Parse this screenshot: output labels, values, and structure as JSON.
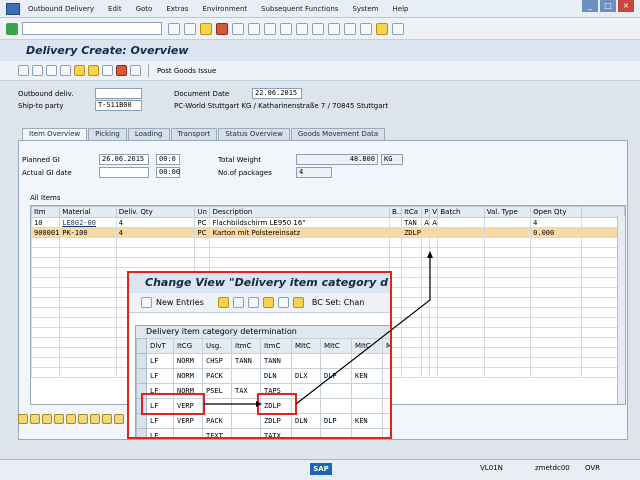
{
  "menubar": {
    "items": [
      "Outbound Delivery",
      "Edit",
      "Goto",
      "Extras",
      "Environment",
      "Subsequent Functions",
      "System",
      "Help"
    ]
  },
  "screen": {
    "title": "Delivery  Create: Overview",
    "app_toolbar_label": "Post Goods Issue"
  },
  "header": {
    "outbound_deliv_label": "Outbound deliv.",
    "outbound_deliv_value": "",
    "ship_to_label": "Ship-to party",
    "ship_to_value": "T-S11B00",
    "document_date_label": "Document Date",
    "document_date_value": "22.06.2015",
    "ship_to_text": "PC-World Stuttgart KG / Katharinenstraße 7 / 70845 Stuttgart"
  },
  "tabs": [
    {
      "label": "Item Overview",
      "active": true
    },
    {
      "label": "Picking",
      "active": false
    },
    {
      "label": "Loading",
      "active": false
    },
    {
      "label": "Transport",
      "active": false
    },
    {
      "label": "Status Overview",
      "active": false
    },
    {
      "label": "Goods Movement Data",
      "active": false
    }
  ],
  "item_overview": {
    "planned_gi_label": "Planned GI",
    "planned_gi_date": "26.06.2015",
    "planned_gi_time": "00:0",
    "actual_gi_label": "Actual GI date",
    "actual_gi_time": "00:00",
    "total_weight_label": "Total Weight",
    "total_weight_value": "48.800",
    "total_weight_unit": "KG",
    "no_packages_label": "No.of packages",
    "no_packages_value": "4",
    "all_items_label": "All Items",
    "columns": [
      "Itm",
      "Material",
      "Deliv. Qty",
      "Un",
      "Description",
      "B..",
      "ItCa",
      "P",
      "V",
      "Batch",
      "Val. Type",
      "Open Qty"
    ],
    "rows": [
      {
        "itm": "10",
        "material": "LE802-00",
        "qty": "4",
        "un": "PC",
        "desc": "Flachbildschirm LE950 16\"",
        "itca": "TAN",
        "p": "A",
        "v": "A",
        "batch": "",
        "valtype": "",
        "openqty": "4",
        "selected": false
      },
      {
        "itm": "900001",
        "material": "PK-100",
        "qty": "4",
        "un": "PC",
        "desc": "Karton mit Polstereinsatz",
        "itca": "ZDLP",
        "p": "",
        "v": "",
        "batch": "",
        "valtype": "",
        "openqty": "0.000",
        "selected": true
      }
    ]
  },
  "popup": {
    "title": "Change View \"Delivery item category d",
    "new_entries_label": "New Entries",
    "bc_set_label": "BC Set: Chan",
    "grid_title": "Delivery item category determination",
    "columns": [
      "DlvT",
      "ItCG",
      "Usg.",
      "ItmC",
      "ItmC",
      "MItC",
      "MItC",
      "MItC",
      "M"
    ],
    "rows": [
      [
        "LF",
        "NORM",
        "CHSP",
        "TANN",
        "TANN",
        "",
        "",
        "",
        ""
      ],
      [
        "LF",
        "NORM",
        "PACK",
        "",
        "DLN",
        "DLX",
        "DLP",
        "KEN",
        ""
      ],
      [
        "LF",
        "NORM",
        "PSEL",
        "TAX",
        "TAPS",
        "",
        "",
        "",
        ""
      ],
      [
        "LF",
        "VERP",
        "",
        "",
        "ZDLP",
        "",
        "",
        "",
        ""
      ],
      [
        "LF",
        "VERP",
        "PACK",
        "",
        "ZDLP",
        "DLN",
        "DLP",
        "KEN",
        ""
      ],
      [
        "LF",
        "",
        "TEXT",
        "",
        "TATX",
        "",
        "",
        "",
        ""
      ]
    ]
  },
  "status": {
    "system": "VL01N",
    "client": "zmetdc00",
    "mode": "OVR"
  },
  "colors": {
    "highlight": "#e2231a",
    "selected_row": "#f6dba8"
  }
}
